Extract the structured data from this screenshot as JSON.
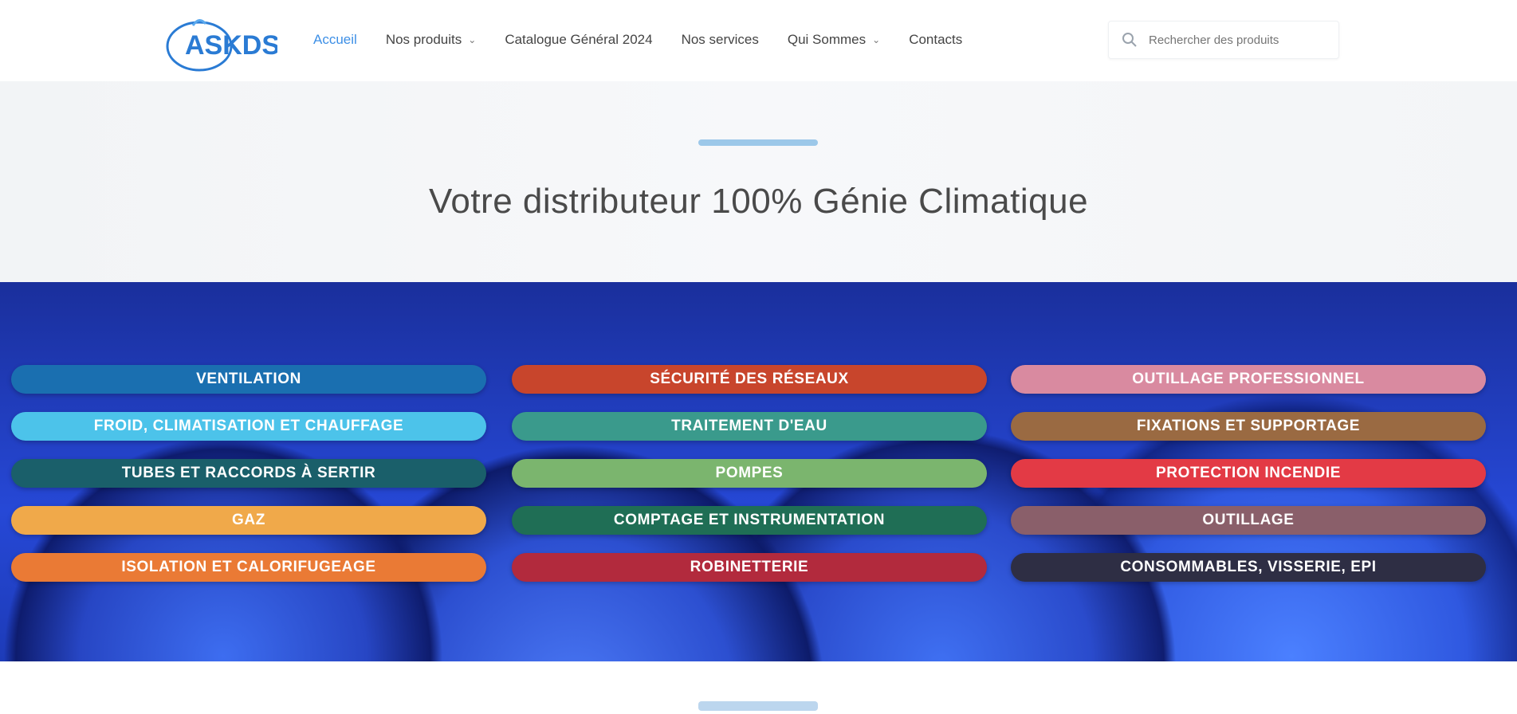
{
  "header": {
    "logo_text": "ASKDS",
    "nav": [
      {
        "label": "Accueil",
        "active": true,
        "dropdown": false
      },
      {
        "label": "Nos produits",
        "active": false,
        "dropdown": true
      },
      {
        "label": "Catalogue Général 2024",
        "active": false,
        "dropdown": false
      },
      {
        "label": "Nos services",
        "active": false,
        "dropdown": false
      },
      {
        "label": "Qui Sommes",
        "active": false,
        "dropdown": true
      },
      {
        "label": "Contacts",
        "active": false,
        "dropdown": false
      }
    ],
    "search": {
      "placeholder": "Rechercher des produits"
    }
  },
  "hero": {
    "tagline": "Votre distributeur 100% Génie Climatique"
  },
  "categories": {
    "col1": [
      {
        "label": "Ventilation",
        "color": "#1a6fb0"
      },
      {
        "label": "Froid, climatisation et chauffage",
        "color": "#4cc3ea"
      },
      {
        "label": "Tubes et raccords à sertir",
        "color": "#1a5f6a"
      },
      {
        "label": "Gaz",
        "color": "#f0a94a"
      },
      {
        "label": "Isolation et calorifugeage",
        "color": "#ea7a35"
      }
    ],
    "col2": [
      {
        "label": "Sécurité des réseaux",
        "color": "#c8452c"
      },
      {
        "label": "Traitement d'eau",
        "color": "#3a9a8c"
      },
      {
        "label": "Pompes",
        "color": "#7bb56e"
      },
      {
        "label": "Comptage et instrumentation",
        "color": "#1f6e55"
      },
      {
        "label": "Robinetterie",
        "color": "#b22a3d"
      }
    ],
    "col3": [
      {
        "label": "Outillage professionnel",
        "color": "#d98aa0"
      },
      {
        "label": "Fixations et supportage",
        "color": "#9a6a42"
      },
      {
        "label": "Protection incendie",
        "color": "#e33a45"
      },
      {
        "label": "Outillage",
        "color": "#8a5f6a"
      },
      {
        "label": "Consommables, visserie, EPI",
        "color": "#2e2e44"
      }
    ]
  }
}
